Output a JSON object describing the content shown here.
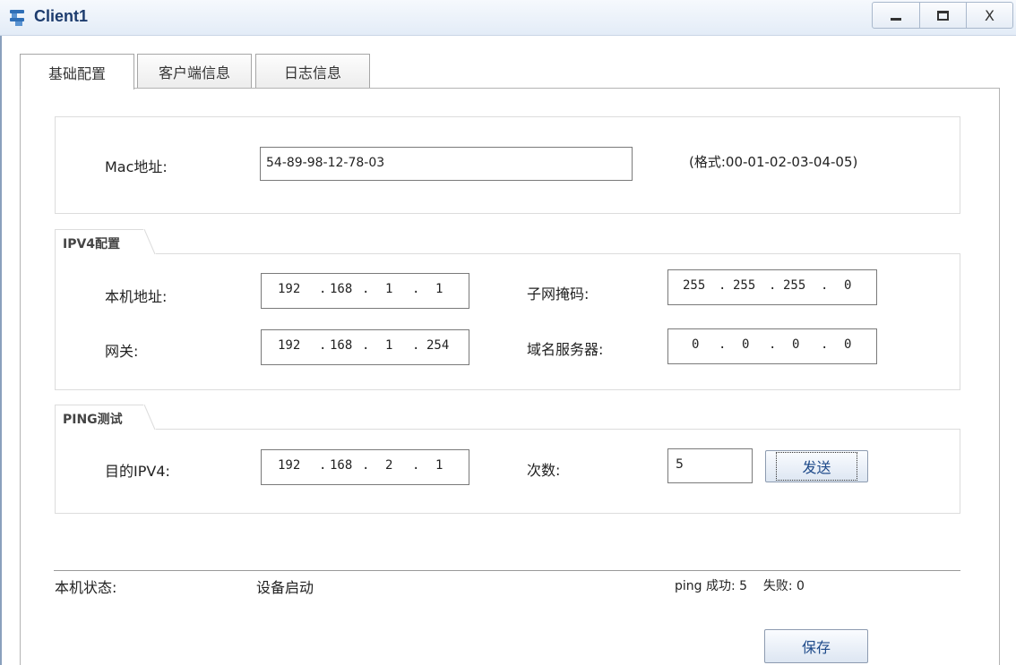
{
  "window": {
    "title": "Client1",
    "controls": {
      "minimize": "_",
      "maximize": "□",
      "close": "X"
    }
  },
  "tabs": [
    {
      "label": "基础配置",
      "active": true
    },
    {
      "label": "客户端信息",
      "active": false
    },
    {
      "label": "日志信息",
      "active": false
    }
  ],
  "mac": {
    "label": "Mac地址:",
    "value": "54-89-98-12-78-03",
    "format_hint": "(格式:00-01-02-03-04-05)"
  },
  "ipv4": {
    "group_title": "IPV4配置",
    "local_address_label": "本机地址:",
    "local_address": [
      "192",
      "168",
      "1",
      "1"
    ],
    "subnet_mask_label": "子网掩码:",
    "subnet_mask": [
      "255",
      "255",
      "255",
      "0"
    ],
    "gateway_label": "网关:",
    "gateway": [
      "192",
      "168",
      "1",
      "254"
    ],
    "dns_label": "域名服务器:",
    "dns": [
      "0",
      "0",
      "0",
      "0"
    ]
  },
  "ping": {
    "group_title": "PING测试",
    "dest_label": "目的IPV4:",
    "dest": [
      "192",
      "168",
      "2",
      "1"
    ],
    "count_label": "次数:",
    "count": "5",
    "send_button": "发送"
  },
  "status": {
    "label": "本机状态:",
    "value": "设备启动",
    "ping_result": "ping 成功: 5    失败: 0"
  },
  "save_button": "保存",
  "colors": {
    "title_text": "#1d3c6e",
    "button_text": "#1e4a8a",
    "frame": "#8aa0bd"
  }
}
